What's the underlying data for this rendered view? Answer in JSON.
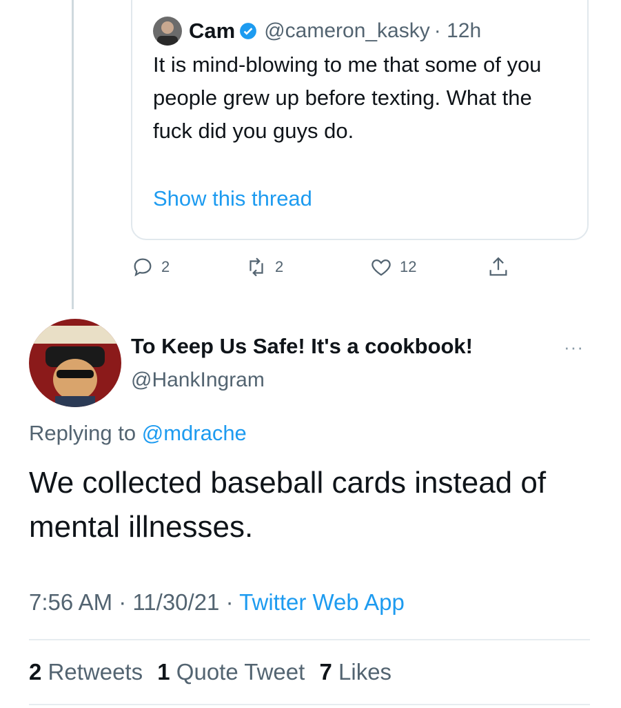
{
  "quoted_tweet": {
    "name": "Cam",
    "handle": "@cameron_kasky",
    "time": "· 12h",
    "text": "It is mind-blowing to me that some of you people grew up before texting. What the fuck did you guys do.",
    "show_thread": "Show this thread"
  },
  "actions": {
    "replies": "2",
    "retweets": "2",
    "likes": "12"
  },
  "tweet": {
    "name": "To Keep Us Safe! It's a cookbook!",
    "handle": "@HankIngram",
    "more": "···",
    "replying_prefix": "Replying to",
    "replying_to": "@mdrache",
    "text": "We collected baseball cards instead of mental illnesses.",
    "time": "7:56 AM · 11/30/21 ·",
    "app": "Twitter Web App",
    "stats": {
      "retweets_count": "2",
      "retweets_label": "Retweets",
      "quotes_count": "1",
      "quotes_label": "Quote Tweet",
      "likes_count": "7",
      "likes_label": "Likes"
    }
  },
  "colors": {
    "accent": "#1d9bf0",
    "muted": "#536471",
    "border": "#e1e8ed"
  },
  "icons": [
    "reply-icon",
    "retweet-icon",
    "like-icon",
    "share-icon",
    "verified-icon",
    "more-icon"
  ]
}
